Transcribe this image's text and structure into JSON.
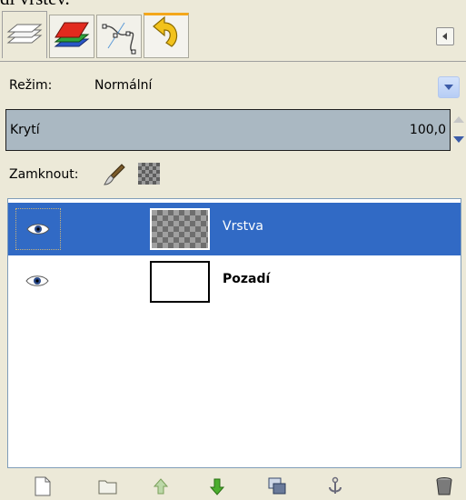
{
  "caption": "di vrstev.",
  "tabs": [
    {
      "name": "layers-tab",
      "icon": "layers-icon"
    },
    {
      "name": "channels-tab",
      "icon": "channels-icon"
    },
    {
      "name": "paths-tab",
      "icon": "paths-icon"
    },
    {
      "name": "undo-history-tab",
      "icon": "undo-icon"
    }
  ],
  "mode": {
    "label": "Režim:",
    "value": "Normální"
  },
  "opacity": {
    "label": "Krytí",
    "value": "100,0"
  },
  "lock": {
    "label": "Zamknout:"
  },
  "layers": [
    {
      "name": "Vrstva",
      "selected": true,
      "visible": true,
      "thumbnail": "transparent"
    },
    {
      "name": "Pozadí",
      "selected": false,
      "visible": true,
      "thumbnail": "white"
    }
  ],
  "toolbar": [
    "new-layer-icon",
    "open-folder-icon",
    "raise-layer-icon",
    "lower-layer-icon",
    "duplicate-layer-icon",
    "anchor-icon",
    "delete-icon"
  ],
  "colors": {
    "selection": "#316ac5",
    "opacity_bar": "#aab8c2",
    "panel": "#ece9d8"
  }
}
